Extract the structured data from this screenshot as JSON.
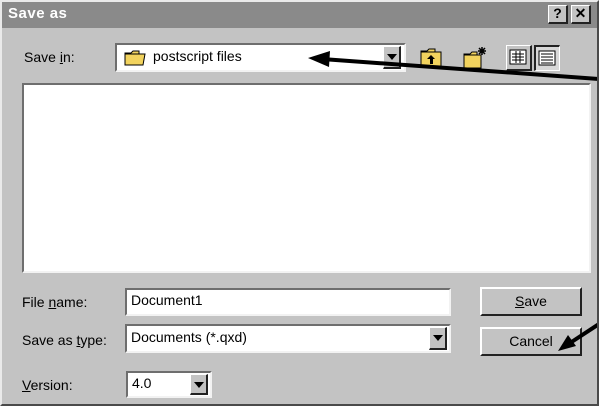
{
  "window": {
    "title": "Save as",
    "help_label": "?",
    "close_label": "✕"
  },
  "save_in": {
    "label_pre": "Save ",
    "label_key": "i",
    "label_post": "n:",
    "value": "postscript files"
  },
  "toolbar": {
    "icons": [
      "folder-up-icon",
      "new-folder-icon",
      "list-view-icon",
      "details-view-icon"
    ]
  },
  "file_name": {
    "label_pre": "File ",
    "label_key": "n",
    "label_post": "ame:",
    "value": "Document1"
  },
  "save_as_type": {
    "label_pre": "Save as ",
    "label_key": "t",
    "label_post": "ype:",
    "value": "Documents (*.qxd)"
  },
  "version": {
    "label_key": "V",
    "label_post": "ersion:",
    "value": "4.0"
  },
  "buttons": {
    "save_key": "S",
    "save_rest": "ave",
    "cancel": "Cancel"
  },
  "colors": {
    "dialog_bg": "#c3c3c3",
    "titlebar_bg": "#8a8a8a",
    "folder_yellow": "#f2d35e"
  }
}
